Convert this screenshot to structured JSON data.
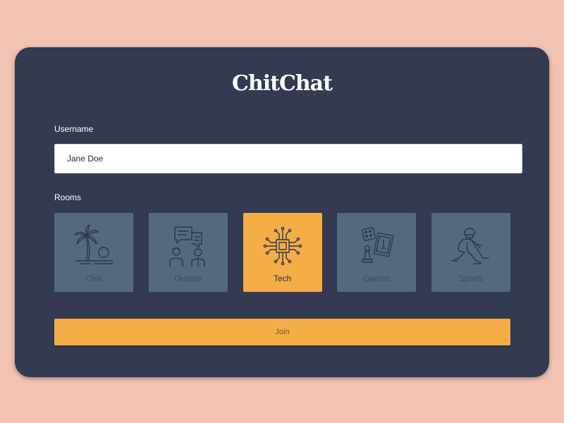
{
  "app": {
    "title": "ChitChat"
  },
  "form": {
    "username_label": "Username",
    "username_value": "Jane Doe",
    "rooms_label": "Rooms",
    "join_label": "Join"
  },
  "rooms": [
    {
      "label": "Chill",
      "icon": "palm-beach-icon",
      "selected": false
    },
    {
      "label": "Debate",
      "icon": "debate-speech-bubbles-icon",
      "selected": false
    },
    {
      "label": "Tech",
      "icon": "circuit-chip-icon",
      "selected": true
    },
    {
      "label": "Games",
      "icon": "board-games-icon",
      "selected": false
    },
    {
      "label": "Sports",
      "icon": "hockey-player-icon",
      "selected": false
    }
  ],
  "colors": {
    "page_background": "#f1c1b1",
    "card_background": "#333a52",
    "accent": "#f4ad47",
    "room_tile": "#53697f",
    "icon_stroke": "#2e3650"
  }
}
